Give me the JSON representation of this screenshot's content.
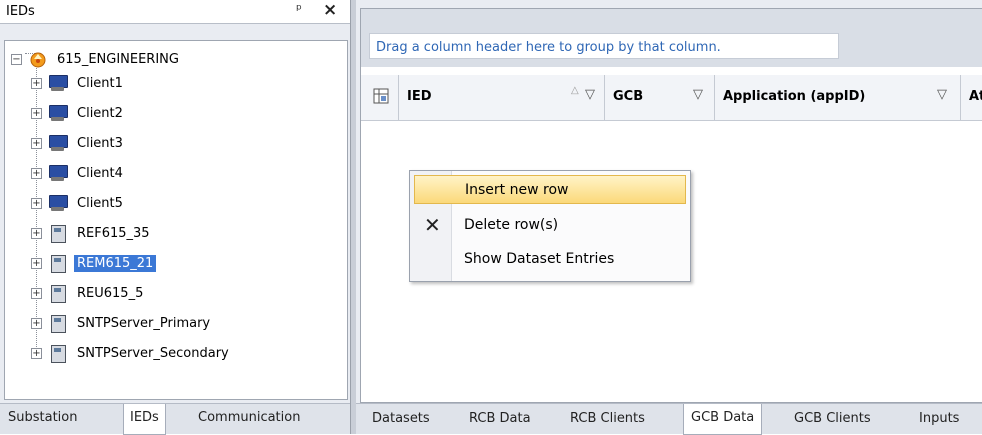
{
  "left_pane": {
    "title": "IEDs",
    "pin_glyph": "ᵖ",
    "close_glyph": "✕",
    "tree": {
      "root": "615_ENGINEERING",
      "items": [
        "Client1",
        "Client2",
        "Client3",
        "Client4",
        "Client5",
        "REF615_35",
        "REM615_21",
        "REU615_5",
        "SNTPServer_Primary",
        "SNTPServer_Secondary"
      ],
      "selected": "REM615_21"
    },
    "tabs": [
      "Substation",
      "IEDs",
      "Communication"
    ],
    "active_tab": "IEDs"
  },
  "grid": {
    "group_hint": "Drag a column header here to group by that column.",
    "columns": [
      "IED",
      "GCB",
      "Application (appID)",
      "At"
    ]
  },
  "context_menu": {
    "items": [
      "Insert new row",
      "Delete row(s)",
      "Show Dataset Entries"
    ],
    "highlighted": "Insert new row"
  },
  "right_tabs": [
    "Datasets",
    "RCB Data",
    "RCB Clients",
    "GCB Data",
    "GCB Clients",
    "Inputs"
  ],
  "right_active_tab": "GCB Data",
  "colors": {
    "selection": "#3b78d6",
    "menu_hot": "#fbd97a",
    "link_text": "#2f67b5"
  }
}
